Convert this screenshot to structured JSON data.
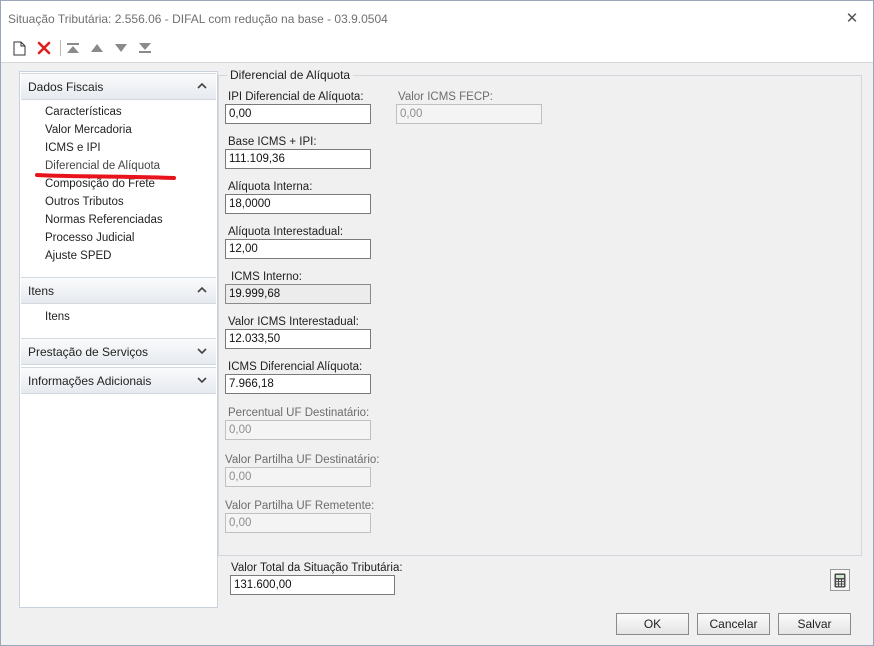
{
  "window": {
    "title": "Situação Tributária: 2.556.06 - DIFAL com redução na base - 03.9.0504",
    "close_glyph": "✕"
  },
  "toolbar": {
    "icons": [
      "new-document-icon",
      "delete-icon",
      "move-first-icon",
      "move-up-icon",
      "move-down-icon",
      "move-last-icon"
    ]
  },
  "sidebar": {
    "sections": [
      {
        "title": "Dados Fiscais",
        "expanded": true,
        "items": [
          "Características",
          "Valor Mercadoria",
          "ICMS e IPI",
          "Diferencial de Alíquota",
          "Composição do Frete",
          "Outros Tributos",
          "Normas Referenciadas",
          "Processo Judicial",
          "Ajuste SPED"
        ]
      },
      {
        "title": "Itens",
        "expanded": true,
        "items": [
          "Itens"
        ]
      },
      {
        "title": "Prestação de Serviços",
        "expanded": false
      },
      {
        "title": "Informações Adicionais",
        "expanded": false
      }
    ],
    "active_item": "Diferencial de Alíquota"
  },
  "form": {
    "group_title": "Diferencial de Alíquota",
    "fields": [
      {
        "label": "IPI Diferencial de Alíquota:",
        "value": "0,00",
        "state": "editable"
      },
      {
        "label": "Base ICMS + IPI:",
        "value": "111.109,36",
        "state": "editable"
      },
      {
        "label": "Alíquota Interna:",
        "value": "18,0000",
        "state": "editable"
      },
      {
        "label": "Alíquota Interestadual:",
        "value": "12,00",
        "state": "editable"
      },
      {
        "label": "ICMS Interno:",
        "value": "19.999,68",
        "state": "readonly"
      },
      {
        "label": "Valor ICMS Interestadual:",
        "value": "12.033,50",
        "state": "editable"
      },
      {
        "label": "ICMS Diferencial Alíquota:",
        "value": "7.966,18",
        "state": "editable"
      },
      {
        "label": "Percentual UF Destinatário:",
        "value": "0,00",
        "state": "disabled"
      },
      {
        "label": "Valor Partilha UF Destinatário:",
        "value": "0,00",
        "state": "disabled"
      },
      {
        "label": "Valor Partilha UF Remetente:",
        "value": "0,00",
        "state": "disabled"
      }
    ],
    "fecp": {
      "label": "Valor ICMS FECP:",
      "value": "0,00",
      "state": "disabled"
    },
    "total": {
      "label": "Valor Total da Situação Tributária:",
      "value": "131.600,00"
    }
  },
  "buttons": {
    "ok": "OK",
    "cancel": "Cancelar",
    "save": "Salvar"
  },
  "colors": {
    "annotation_red": "#e8141c",
    "window_bg": "#f0f0f0"
  }
}
